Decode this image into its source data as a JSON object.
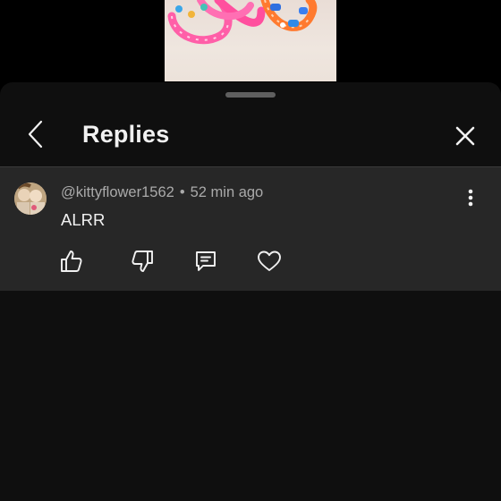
{
  "header": {
    "title": "Replies"
  },
  "comment": {
    "author": "@kittyflower1562",
    "separator": "•",
    "time": "52 min ago",
    "text": "ALRR"
  },
  "icons": {
    "back": "chevron-left-icon",
    "close": "close-icon",
    "more": "more-vertical-icon",
    "like": "thumbs-up-icon",
    "dislike": "thumbs-down-icon",
    "reply": "reply-comment-icon",
    "heart": "heart-icon"
  }
}
